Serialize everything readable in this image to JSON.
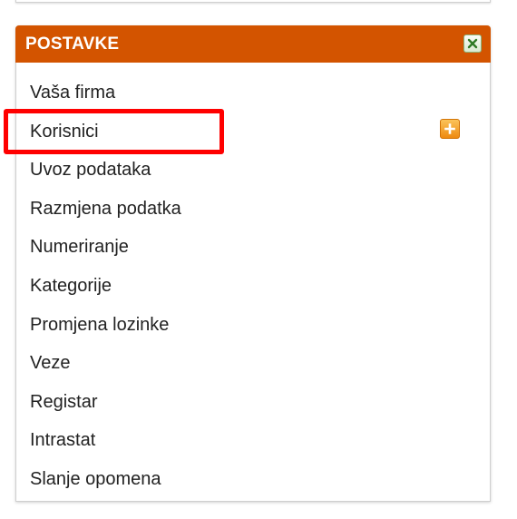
{
  "panel": {
    "title": "POSTAVKE",
    "header_color": "#d35400",
    "close_icon": "close-icon"
  },
  "menu": {
    "items": [
      {
        "label": "Vaša firma"
      },
      {
        "label": "Korisnici",
        "action_icon": "add-icon"
      },
      {
        "label": "Uvoz podataka"
      },
      {
        "label": "Razmjena podatka"
      },
      {
        "label": "Numeriranje"
      },
      {
        "label": "Kategorije"
      },
      {
        "label": "Promjena lozinke"
      },
      {
        "label": "Veze"
      },
      {
        "label": "Registar"
      },
      {
        "label": "Intrastat"
      },
      {
        "label": "Slanje opomena"
      }
    ]
  },
  "annotation": {
    "highlight_color": "#ff0000",
    "highlighted_item": "Korisnici"
  }
}
